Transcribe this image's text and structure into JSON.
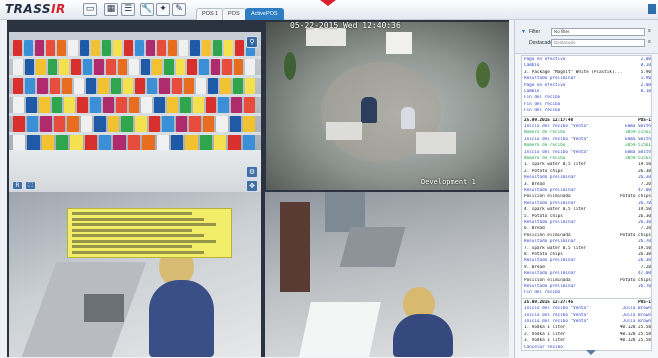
{
  "app": {
    "logo_main": "TRASS",
    "logo_accent": "IR",
    "tabs": [
      {
        "label": "POS 1"
      },
      {
        "label": "POS"
      },
      {
        "label": "ActivePOS"
      }
    ]
  },
  "cameras": {
    "cam2_overlay": "05-22-2015 Wed 12:40:36",
    "cam2_caption": "Development 1"
  },
  "panel": {
    "filter_label": "Filter",
    "filter_value": "No filter",
    "source_label": "Destacado",
    "source_value": "Destacado"
  },
  "receipts": [
    {
      "text": "Pago en efectivo",
      "value": "2.00",
      "color": "#2a3fc7"
    },
    {
      "text": "Cambio",
      "value": "0.10",
      "color": "#2a3fc7"
    },
    {
      "text": "3. Package \"Magnit\" White (Plastik)...",
      "value": "5.90",
      "color": "#111"
    },
    {
      "text": "   Resultado preliminar",
      "value": "1.90",
      "color": "#2a3fc7"
    },
    {
      "text": "   Pago en efectivo",
      "value": "2.00",
      "color": "#2a3fc7"
    },
    {
      "text": "   Cambio",
      "value": "0.10",
      "color": "#2a3fc7"
    },
    {
      "text": "   Fin del recibo",
      "value": "",
      "color": "#2a3fc7"
    },
    {
      "text": "   Fin del recibo",
      "value": "",
      "color": "#2a3fc7"
    },
    {
      "text": "   Fin del recibo",
      "value": "",
      "color": "#2a3fc7"
    },
    {
      "text": "25.09.2015 12:17:48",
      "value": "POS-1",
      "color": "#111",
      "sep": true
    },
    {
      "text": "   Inicio del recibo \"Venta\"",
      "value": "Emma Smith",
      "color": "#2a3fc7"
    },
    {
      "text": "   Número de recibo",
      "value": "3859-51561",
      "color": "#1fa34a"
    },
    {
      "text": "   Inicio del recibo \"Venta\"",
      "value": "Emma Smith",
      "color": "#2a3fc7"
    },
    {
      "text": "   Número de recibo",
      "value": "3859-51561",
      "color": "#1fa34a"
    },
    {
      "text": "   Inicio del recibo \"Venta\"",
      "value": "Emma Smith",
      "color": "#2a3fc7"
    },
    {
      "text": "   Número de recibo",
      "value": "3859-51561",
      "color": "#1fa34a"
    },
    {
      "text": "1. spark water 0,5 liter",
      "value": "19.50",
      "color": "#111"
    },
    {
      "text": "2. Potato chips",
      "value": "26.30",
      "color": "#111"
    },
    {
      "text": "   Resultado preliminar",
      "value": "26.30",
      "color": "#2a3fc7"
    },
    {
      "text": "3. Bread",
      "value": "7.20",
      "color": "#111"
    },
    {
      "text": "   Resultado preliminar",
      "value": "47.00",
      "color": "#2a3fc7"
    },
    {
      "text": "   Posición eliminada",
      "value": "Potato chips",
      "color": "#111"
    },
    {
      "text": "   Resultado preliminar",
      "value": "26.70",
      "color": "#2a3fc7"
    },
    {
      "text": "4. spark water 0,5 liter",
      "value": "19.50",
      "color": "#111"
    },
    {
      "text": "5. Potato chips",
      "value": "26.30",
      "color": "#111"
    },
    {
      "text": "   Resultado preliminar",
      "value": "26.30",
      "color": "#2a3fc7"
    },
    {
      "text": "6. Bread",
      "value": "7.20",
      "color": "#111"
    },
    {
      "text": "   Posición eliminada",
      "value": "Potato chips",
      "color": "#111"
    },
    {
      "text": "   Resultado preliminar",
      "value": "26.70",
      "color": "#2a3fc7"
    },
    {
      "text": "7. spark water 0,5 liter",
      "value": "19.50",
      "color": "#111"
    },
    {
      "text": "8. Potato chips",
      "value": "26.30",
      "color": "#111"
    },
    {
      "text": "   Resultado preliminar",
      "value": "26.30",
      "color": "#2a3fc7"
    },
    {
      "text": "9. Bread",
      "value": "7.20",
      "color": "#111"
    },
    {
      "text": "   Resultado preliminar",
      "value": "47.00",
      "color": "#2a3fc7"
    },
    {
      "text": "   Posición eliminada",
      "value": "Potato chips",
      "color": "#111"
    },
    {
      "text": "   Resultado preliminar",
      "value": "26.70",
      "color": "#2a3fc7"
    },
    {
      "text": "   Fin del recibo",
      "value": "",
      "color": "#2a3fc7"
    },
    {
      "text": "25.09.2015 12:27:45",
      "value": "POS-1",
      "color": "#111",
      "sep": true
    },
    {
      "text": "   Inicio del recibo \"Venta\"",
      "value": "Julia Brown",
      "color": "#2a3fc7"
    },
    {
      "text": "   Inicio del recibo \"Venta\"",
      "value": "Julia Brown",
      "color": "#2a3fc7"
    },
    {
      "text": "   Inicio del recibo \"Venta\"",
      "value": "Julia Brown",
      "color": "#2a3fc7"
    },
    {
      "text": "1. Vodka 1 liter",
      "value": "¥0.128 25.58",
      "color": "#111"
    },
    {
      "text": "2. Vodka 1 liter",
      "value": "¥0.128 25.58",
      "color": "#111"
    },
    {
      "text": "3. Vodka 1 liter",
      "value": "¥0.128 25.58",
      "color": "#111"
    },
    {
      "text": "   Cancelar recibo",
      "value": "",
      "color": "#2a3fc7"
    }
  ]
}
